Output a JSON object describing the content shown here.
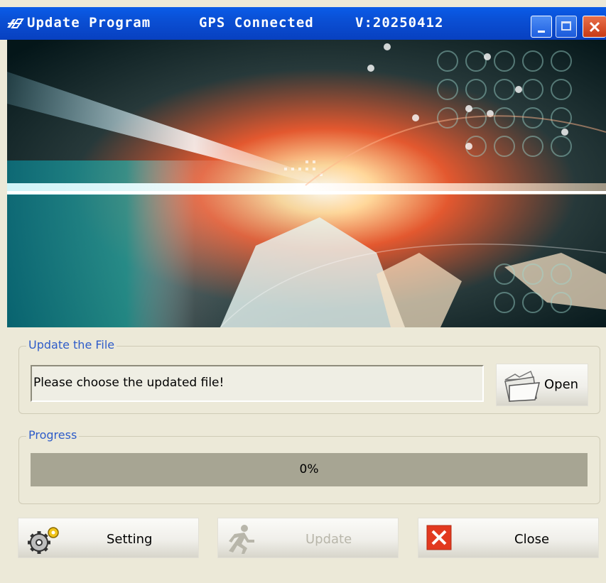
{
  "window": {
    "title": "Update Program",
    "gps_status": "GPS Connected",
    "version": "V:20250412",
    "title_bar_color": "#0a52db"
  },
  "file_group": {
    "legend": "Update the File",
    "file_path_value": "Please choose the updated file!",
    "open_button_label": "Open",
    "open_icon": "folder-open-icon"
  },
  "progress_group": {
    "legend": "Progress",
    "value_percent": 0,
    "label": "0%"
  },
  "actions": {
    "setting_label": "Setting",
    "setting_icon": "gears-icon",
    "update_label": "Update",
    "update_icon": "running-man-icon",
    "update_enabled": false,
    "close_label": "Close",
    "close_icon": "close-x-icon"
  },
  "colors": {
    "legend_text": "#2e5cc9",
    "window_background": "#ece9d8",
    "progress_track": "#a7a593",
    "close_icon_red": "#e2391f"
  }
}
